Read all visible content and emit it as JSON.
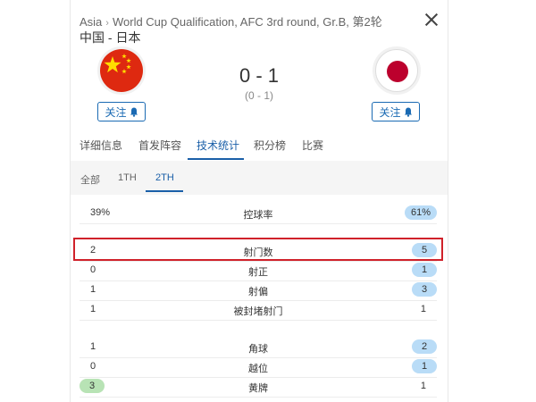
{
  "header": {
    "region": "Asia",
    "separator": "›",
    "competition": "World Cup Qualification, AFC 3rd round, Gr.B, 第2轮",
    "teams": "中国 - 日本"
  },
  "match": {
    "score": "0 - 1",
    "halftime": "(0 - 1)",
    "home_follow": "关注",
    "away_follow": "关注"
  },
  "tabs": [
    {
      "label": "详细信息"
    },
    {
      "label": "首发阵容"
    },
    {
      "label": "技术统计"
    },
    {
      "label": "积分榜"
    },
    {
      "label": "比赛"
    }
  ],
  "active_tab": "技术统计",
  "subtabs": [
    {
      "label": "全部"
    },
    {
      "label": "1TH"
    },
    {
      "label": "2TH"
    }
  ],
  "active_subtab": "2TH",
  "stats": [
    {
      "label": "控球率",
      "home": "39%",
      "away": "61%",
      "leader": "away"
    },
    {
      "label": "射门数",
      "home": "2",
      "away": "5",
      "leader": "away",
      "highlighted": true
    },
    {
      "label": "射正",
      "home": "0",
      "away": "1",
      "leader": "away"
    },
    {
      "label": "射偏",
      "home": "1",
      "away": "3",
      "leader": "away"
    },
    {
      "label": "被封堵射门",
      "home": "1",
      "away": "1",
      "leader": "none"
    },
    {
      "label": "角球",
      "home": "1",
      "away": "2",
      "leader": "away"
    },
    {
      "label": "越位",
      "home": "0",
      "away": "1",
      "leader": "away"
    },
    {
      "label": "黄牌",
      "home": "3",
      "away": "1",
      "leader": "home"
    }
  ],
  "colors": {
    "accent": "#1a5fa8",
    "away_pill": "#b9dcf7",
    "home_pill": "#b8e3b5",
    "highlight_border": "#d0212a",
    "china_red": "#de2910",
    "japan_red": "#bc002d"
  },
  "icons": [
    "close-icon",
    "bell-icon",
    "china-flag-icon",
    "japan-flag-icon"
  ]
}
